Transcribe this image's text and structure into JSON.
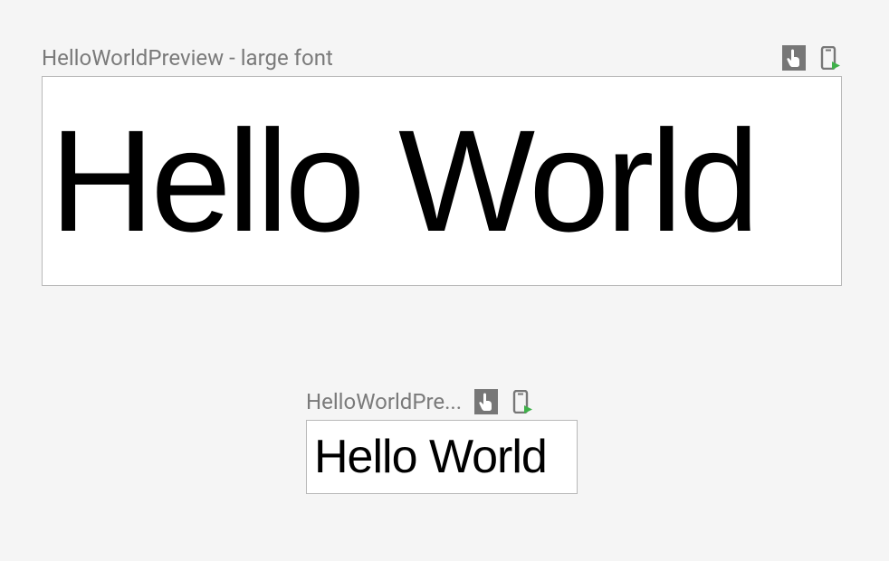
{
  "previews": {
    "large": {
      "title": "HelloWorldPreview - large font",
      "content": "Hello World"
    },
    "small": {
      "title": "HelloWorldPre...",
      "content": "Hello World"
    }
  }
}
